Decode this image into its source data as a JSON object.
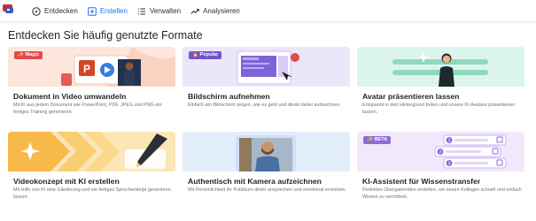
{
  "nav": {
    "items": [
      {
        "label": "Entdecken",
        "icon": "compass-icon",
        "active": false
      },
      {
        "label": "Erstellen",
        "icon": "plus-square-icon",
        "active": true
      },
      {
        "label": "Verwalten",
        "icon": "list-icon",
        "active": false
      },
      {
        "label": "Analysieren",
        "icon": "trend-icon",
        "active": false
      }
    ]
  },
  "heading": "Entdecken Sie häufig genutzte Formate",
  "colors": {
    "accent": "#1f6feb",
    "magic": "#e5484d",
    "popular": "#6e56cf",
    "beta": "#8e6ad8"
  },
  "cards": [
    {
      "title": "Dokument in Video umwandeln",
      "badge": "✨ Magic",
      "desc": "Mit KI aus jedem Dokument wie PowerPoint, PDF, JPEG und PNG ein fertiges Training generieren."
    },
    {
      "title": "Bildschirm aufnehmen",
      "badge": "🔥 Popular",
      "desc": "Einfach am Bildschirm zeigen, wie es geht und direkt dabei aufzeichnen."
    },
    {
      "title": "Avatar präsentieren lassen",
      "badge": "",
      "desc": "Entspannt in den Hintergrund treten und unsere KI-Avatare präsentieren lassen."
    },
    {
      "title": "Videokonzept mit KI erstellen",
      "badge": "",
      "desc": "Mit Hilfe von KI eine Gliederung und ein fertiges Sprecherskript generieren lassen."
    },
    {
      "title": "Authentisch mit Kamera aufzeichnen",
      "badge": "",
      "desc": "Mit Persönlichkeit Ihr Publikum direkt ansprechen und emotional erreichen."
    },
    {
      "title": "KI-Assistent für Wissenstransfer",
      "badge": "✨ BETA",
      "desc": "Perfektes Übergabevideo erstellen, um neuen Kollegen schnell und einfach Wissen zu vermitteln."
    }
  ]
}
